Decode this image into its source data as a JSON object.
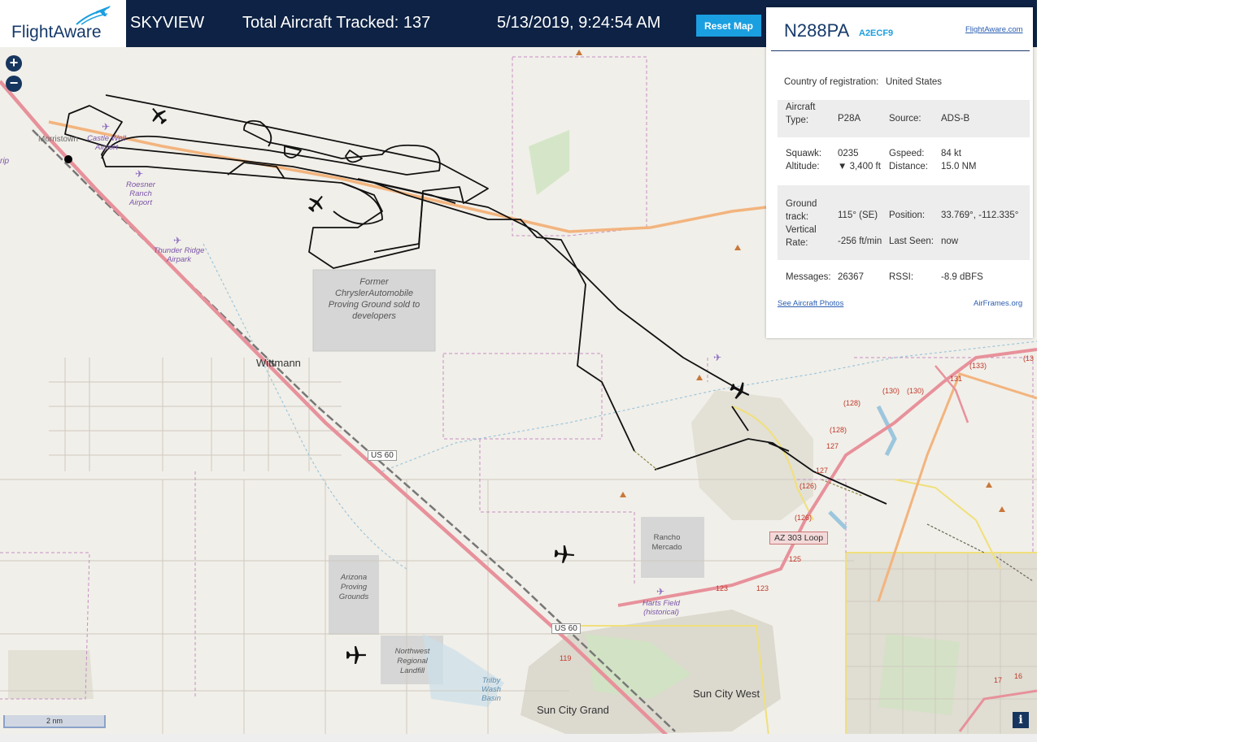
{
  "header": {
    "logo_text": "FlightAware",
    "app_name": "SKYVIEW",
    "aircraft_tracked": "Total Aircraft Tracked: 137",
    "datetime": "5/13/2019, 9:24:54 AM",
    "reset_label": "Reset Map"
  },
  "map": {
    "zoom_in": "+",
    "zoom_out": "−",
    "places": {
      "morristown": "Morristown",
      "wittmann": "Wittmann",
      "sun_city_west": "Sun City West",
      "sun_city_grand": "Sun City Grand",
      "rip": "rip"
    },
    "features": {
      "castle_well": "Castle Well Airport",
      "roesner": "Roesner Ranch Airport",
      "thunder_ridge": "Thunder Ridge Airpark",
      "chrysler": "Former ChryslerAutomobile Proving Ground sold to developers",
      "az_proving": "Arizona Proving Grounds",
      "landfill": "Northwest Regional Landfill",
      "rancho": "Rancho Mercado",
      "harts": "Harts Field (historical)",
      "trilby": "Trilby Wash Basin"
    },
    "roads": {
      "us60_a": "US 60",
      "us60_b": "US 60",
      "az303": "AZ 303 Loop"
    },
    "route_numbers": [
      "(133)",
      "(130)",
      "(130)",
      "131",
      "(128)",
      "(128)",
      "127",
      "127",
      "(126)",
      "(126)",
      "125",
      "123",
      "123",
      "119",
      "17",
      "16",
      "(13"
    ],
    "scale": "2 nm",
    "info": "i"
  },
  "panel": {
    "registration": "N288PA",
    "hex": "A2ECF9",
    "flightaware_link": "FlightAware.com",
    "country_label": "Country of registration:",
    "country_value": "United States",
    "aircraft_type_label": "Aircraft Type:",
    "aircraft_type_value": "P28A",
    "source_label": "Source:",
    "source_value": "ADS-B",
    "squawk_label": "Squawk:",
    "squawk_value": "0235",
    "gspeed_label": "Gspeed:",
    "gspeed_value": "84 kt",
    "altitude_label": "Altitude:",
    "altitude_value": "▼ 3,400 ft",
    "distance_label": "Distance:",
    "distance_value": "15.0 NM",
    "ground_track_label": "Ground track:",
    "ground_track_value": "115° (SE)",
    "position_label": "Position:",
    "position_value": "33.769°, -112.335°",
    "vertical_rate_label": "Vertical Rate:",
    "vertical_rate_value": "-256 ft/min",
    "last_seen_label": "Last Seen:",
    "last_seen_value": "now",
    "messages_label": "Messages:",
    "messages_value": "26367",
    "rssi_label": "RSSI:",
    "rssi_value": "-8.9 dBFS",
    "photos_link": "See Aircraft Photos",
    "airframes_link": "AirFrames.org"
  },
  "colors": {
    "header_bg": "#0d2244",
    "accent": "#1a9fe0",
    "map_bg": "#f1efe9",
    "track": "#111111"
  }
}
